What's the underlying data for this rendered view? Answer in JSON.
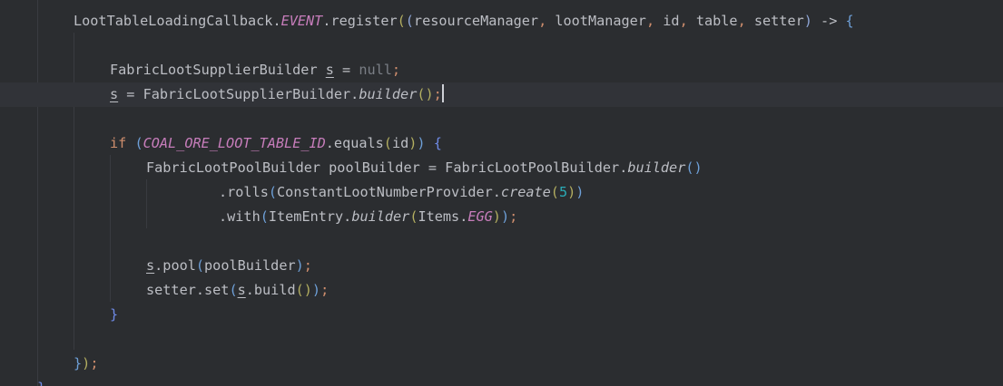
{
  "editor": {
    "lines": [
      {
        "id": "l1",
        "tokens": [
          {
            "t": "LootTableLoadingCallback.",
            "c": "plain"
          },
          {
            "t": "EVENT",
            "c": "static"
          },
          {
            "t": ".register",
            "c": "plain"
          },
          {
            "t": "(",
            "c": "paren-c"
          },
          {
            "t": "(",
            "c": "paren-a"
          },
          {
            "t": "resourceManager",
            "c": "plain"
          },
          {
            "t": ", ",
            "c": "punct"
          },
          {
            "t": "lootManager",
            "c": "plain"
          },
          {
            "t": ", ",
            "c": "punct"
          },
          {
            "t": "id",
            "c": "plain"
          },
          {
            "t": ", ",
            "c": "punct"
          },
          {
            "t": "table",
            "c": "plain"
          },
          {
            "t": ", ",
            "c": "punct"
          },
          {
            "t": "setter",
            "c": "plain"
          },
          {
            "t": ")",
            "c": "paren-a"
          },
          {
            "t": " -> ",
            "c": "arrow"
          },
          {
            "t": "{",
            "c": "paren-b"
          }
        ]
      },
      {
        "id": "l2",
        "tokens": []
      },
      {
        "id": "l3",
        "tokens": [
          {
            "t": "FabricLootSupplierBuilder ",
            "c": "plain"
          },
          {
            "t": "s",
            "c": "var"
          },
          {
            "t": " = ",
            "c": "plain"
          },
          {
            "t": "null",
            "c": "null"
          },
          {
            "t": ";",
            "c": "punct"
          }
        ]
      },
      {
        "id": "l4",
        "current": true,
        "tokens": [
          {
            "t": "s",
            "c": "var"
          },
          {
            "t": " = FabricLootSupplierBuilder.",
            "c": "plain"
          },
          {
            "t": "builder",
            "c": "method-static"
          },
          {
            "t": "()",
            "c": "paren-c"
          },
          {
            "t": ";",
            "c": "punct"
          }
        ]
      },
      {
        "id": "l5",
        "tokens": []
      },
      {
        "id": "l6",
        "tokens": [
          {
            "t": "if",
            "c": "keyword"
          },
          {
            "t": " ",
            "c": "plain"
          },
          {
            "t": "(",
            "c": "paren-b"
          },
          {
            "t": "COAL_ORE_LOOT_TABLE_ID",
            "c": "const"
          },
          {
            "t": ".equals",
            "c": "plain"
          },
          {
            "t": "(",
            "c": "paren-c"
          },
          {
            "t": "id",
            "c": "plain"
          },
          {
            "t": ")",
            "c": "paren-c"
          },
          {
            "t": ")",
            "c": "paren-b"
          },
          {
            "t": " ",
            "c": "plain"
          },
          {
            "t": "{",
            "c": "brace"
          }
        ]
      },
      {
        "id": "l7",
        "tokens": [
          {
            "t": "FabricLootPoolBuilder poolBuilder = FabricLootPoolBuilder.",
            "c": "plain"
          },
          {
            "t": "builder",
            "c": "method-static"
          },
          {
            "t": "()",
            "c": "paren-b"
          }
        ]
      },
      {
        "id": "l8",
        "tokens": [
          {
            "t": ".rolls",
            "c": "plain"
          },
          {
            "t": "(",
            "c": "paren-b"
          },
          {
            "t": "ConstantLootNumberProvider.",
            "c": "plain"
          },
          {
            "t": "create",
            "c": "method-static"
          },
          {
            "t": "(",
            "c": "paren-c"
          },
          {
            "t": "5",
            "c": "number"
          },
          {
            "t": ")",
            "c": "paren-c"
          },
          {
            "t": ")",
            "c": "paren-b"
          }
        ]
      },
      {
        "id": "l9",
        "tokens": [
          {
            "t": ".with",
            "c": "plain"
          },
          {
            "t": "(",
            "c": "paren-b"
          },
          {
            "t": "ItemEntry.",
            "c": "plain"
          },
          {
            "t": "builder",
            "c": "method-static"
          },
          {
            "t": "(",
            "c": "paren-c"
          },
          {
            "t": "Items.",
            "c": "plain"
          },
          {
            "t": "EGG",
            "c": "static"
          },
          {
            "t": ")",
            "c": "paren-c"
          },
          {
            "t": ")",
            "c": "paren-b"
          },
          {
            "t": ";",
            "c": "punct"
          }
        ]
      },
      {
        "id": "l10",
        "tokens": []
      },
      {
        "id": "l11",
        "tokens": [
          {
            "t": "s",
            "c": "var"
          },
          {
            "t": ".pool",
            "c": "plain"
          },
          {
            "t": "(",
            "c": "paren-b"
          },
          {
            "t": "poolBuilder",
            "c": "plain"
          },
          {
            "t": ")",
            "c": "paren-b"
          },
          {
            "t": ";",
            "c": "punct"
          }
        ]
      },
      {
        "id": "l12",
        "tokens": [
          {
            "t": "setter.set",
            "c": "plain"
          },
          {
            "t": "(",
            "c": "paren-b"
          },
          {
            "t": "s",
            "c": "var"
          },
          {
            "t": ".build",
            "c": "plain"
          },
          {
            "t": "()",
            "c": "paren-c"
          },
          {
            "t": ")",
            "c": "paren-b"
          },
          {
            "t": ";",
            "c": "punct"
          }
        ]
      },
      {
        "id": "l13",
        "tokens": [
          {
            "t": "}",
            "c": "brace"
          }
        ]
      },
      {
        "id": "l14",
        "tokens": []
      },
      {
        "id": "l15",
        "tokens": [
          {
            "t": "}",
            "c": "paren-b"
          },
          {
            "t": ")",
            "c": "paren-c"
          },
          {
            "t": ";",
            "c": "punct"
          }
        ]
      },
      {
        "id": "l16",
        "tokens": [
          {
            "t": "}",
            "c": "brace"
          }
        ]
      }
    ]
  }
}
